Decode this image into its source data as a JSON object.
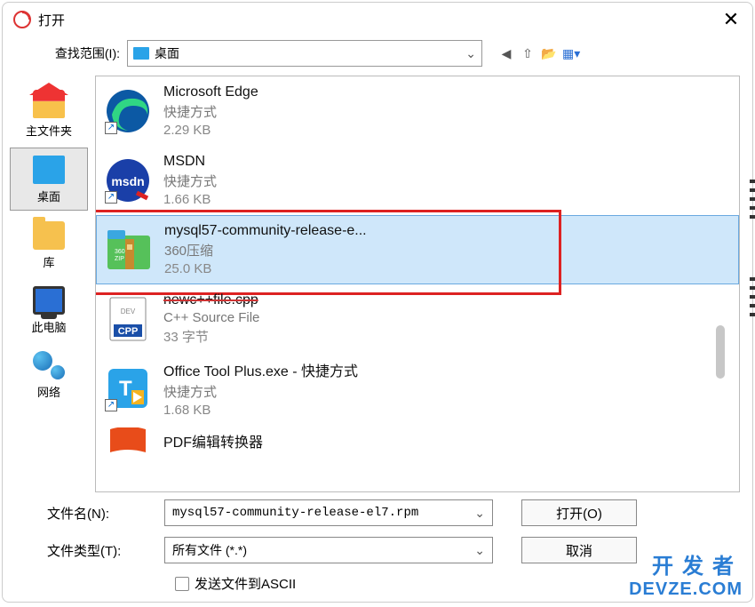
{
  "title": "打开",
  "lookup": {
    "label": "查找范围(I):",
    "value": "桌面"
  },
  "sidebar": {
    "items": [
      {
        "label": "主文件夹",
        "icon": "home-icon"
      },
      {
        "label": "桌面",
        "icon": "desktop-icon",
        "selected": true
      },
      {
        "label": "库",
        "icon": "library-icon"
      },
      {
        "label": "此电脑",
        "icon": "this-pc-icon"
      },
      {
        "label": "网络",
        "icon": "network-icon"
      }
    ]
  },
  "files": [
    {
      "name": "Microsoft Edge",
      "type": "快捷方式",
      "size": "2.29 KB",
      "icon": "edge-icon",
      "shortcut": true
    },
    {
      "name": "MSDN",
      "type": "快捷方式",
      "size": "1.66 KB",
      "icon": "msdn-icon",
      "shortcut": true
    },
    {
      "name": "mysql57-community-release-e...",
      "type": "360压缩",
      "size": "25.0 KB",
      "icon": "zip-icon",
      "selected": true,
      "highlighted": true
    },
    {
      "name": "newc++file.cpp",
      "type": "C++ Source File",
      "size": "33 字节",
      "icon": "cpp-icon",
      "strike": true
    },
    {
      "name": "Office Tool Plus.exe - 快捷方式",
      "type": "快捷方式",
      "size": "1.68 KB",
      "icon": "office-tool-icon",
      "shortcut": true
    },
    {
      "name": "PDF编辑转换器",
      "type": "",
      "size": "",
      "icon": "pdf-icon",
      "partial": true
    }
  ],
  "form": {
    "filename_label": "文件名(N):",
    "filename_value": "mysql57-community-release-el7.rpm",
    "filetype_label": "文件类型(T):",
    "filetype_value": "所有文件 (*.*)",
    "open_btn": "打开(O)",
    "cancel_btn": "取消",
    "ascii_checkbox": "发送文件到ASCII"
  },
  "watermark": {
    "line1": "开发者",
    "line2": "DEVZE.COM"
  }
}
